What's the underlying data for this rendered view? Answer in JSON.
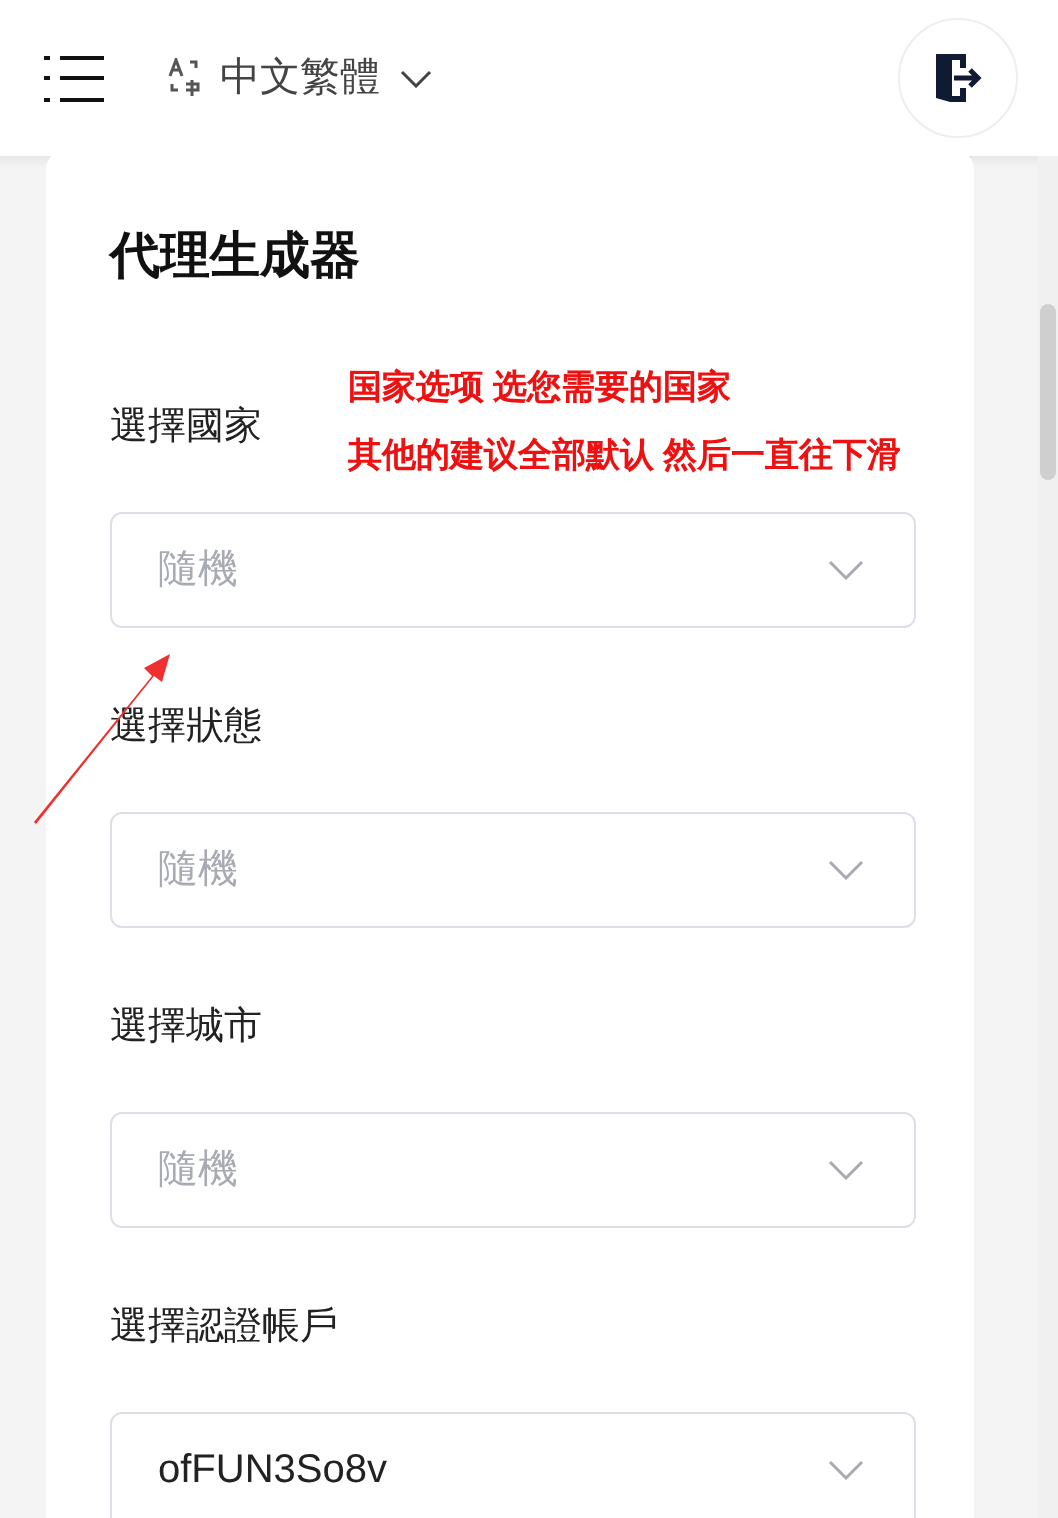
{
  "header": {
    "language": "中文繁體"
  },
  "title": "代理生成器",
  "fields": [
    {
      "label": "選擇國家",
      "placeholder": "隨機"
    },
    {
      "label": "選擇狀態",
      "placeholder": "隨機"
    },
    {
      "label": "選擇城市",
      "placeholder": "隨機"
    },
    {
      "label": "選擇認證帳戶",
      "value": "ofFUN3So8v"
    }
  ],
  "annotation": {
    "lines": [
      "国家选项 选您需要的国家",
      "其他的建议全部默认 然后一直往下滑"
    ]
  }
}
